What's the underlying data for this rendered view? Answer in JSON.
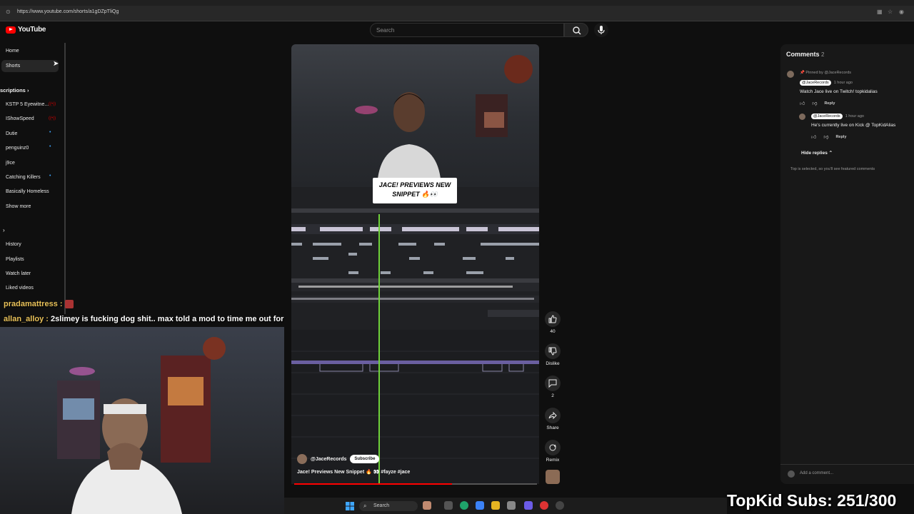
{
  "browser": {
    "url": "https://www.youtube.com/shorts/a1gDZpTliQg"
  },
  "masthead": {
    "logo_text": "YouTube",
    "search_placeholder": "Search"
  },
  "sidebar": {
    "items": [
      {
        "label": "Home"
      },
      {
        "label": "Shorts"
      }
    ],
    "subscriptions_heading": "scriptions",
    "subscriptions": [
      {
        "label": "KSTP 5 Eyewitne...",
        "badge": "live"
      },
      {
        "label": "IShowSpeed",
        "badge": "live"
      },
      {
        "label": "Dutie",
        "badge": "dot"
      },
      {
        "label": "penguinz0",
        "badge": "dot"
      },
      {
        "label": "j9ce",
        "badge": ""
      },
      {
        "label": "Catching Killers",
        "badge": "dot"
      },
      {
        "label": "Basically Homeless",
        "badge": ""
      }
    ],
    "show_more": "Show more",
    "you_items": [
      {
        "label": "History"
      },
      {
        "label": "Playlists"
      },
      {
        "label": "Watch later"
      },
      {
        "label": "Liked videos"
      }
    ]
  },
  "short": {
    "caption_line1": "JACE! PREVIEWS NEW",
    "caption_line2": "SNIPPET 🔥👀",
    "channel": "@JaceRecords",
    "subscribe_label": "Subscribe",
    "title": "Jace! Previews New Snippet 🔥 👀 #fayze #jace",
    "progress": 0.65
  },
  "actions": {
    "like_count": "40",
    "dislike_label": "Dislike",
    "comment_count": "2",
    "share_label": "Share",
    "remix_label": "Remix"
  },
  "comments": {
    "heading": "Comments",
    "count": "2",
    "pinned_by": "Pinned by @JaceRecords",
    "comment1_author": "@JaceRecords",
    "comment1_time": "1 hour ago",
    "comment1_text": "Watch Jace live on Twitch! topkidalias",
    "reply_label": "Reply",
    "comment2_author": "@JaceRecords",
    "comment2_time": "1 hour ago",
    "comment2_text": "He's currently live on Kick @ TopKidAlias",
    "reply2_label": "Reply",
    "hide_replies": "Hide replies",
    "footer_note": "Top is selected, so you'll see featured comments",
    "add_comment_placeholder": "Add a comment..."
  },
  "stream_overlay": {
    "chat1_user": "pradamattress :",
    "chat2_user": "allan_alloy :",
    "chat2_text": " 2slimey is fucking dog shit.. max told a mod to time me out for",
    "sub_goal": "TopKid Subs: 251/300"
  },
  "taskbar": {
    "search_label": "Search"
  },
  "colors": {
    "accent_red": "#ff0000",
    "background": "#0f0f0f",
    "playhead": "#6fd23a",
    "chat_username": "#e9c25a"
  }
}
